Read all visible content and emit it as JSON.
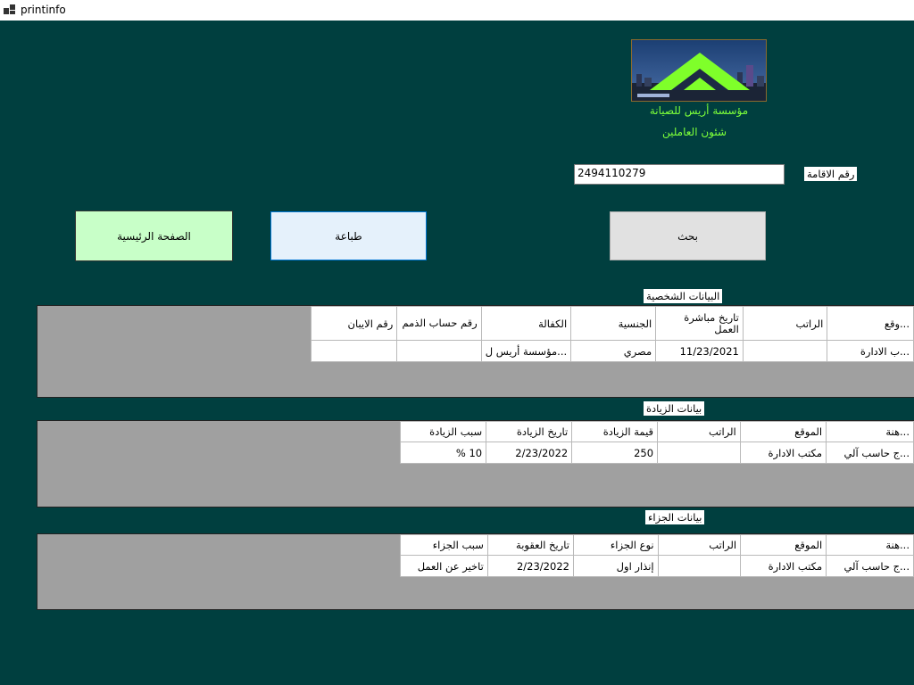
{
  "window": {
    "title": "printinfo"
  },
  "header": {
    "company_name": "مؤسسة أريس للصيانة",
    "department": "شئون العاملين"
  },
  "search": {
    "label": "رقم الاقامة",
    "value": "2494110279"
  },
  "buttons": {
    "home": "الصفحة الرئيسية",
    "print": "طباعة",
    "search": "بحث"
  },
  "colors": {
    "background": "#003f3f",
    "accent_text": "#7cff3a",
    "home_button": "#c8ffc8",
    "print_button": "#e5f1fb",
    "search_button": "#e1e1e1"
  },
  "personal": {
    "section_label": "البيانات الشخصية",
    "columns": [
      "...وقع",
      "الراتب",
      "تاريخ مباشرة العمل",
      "الجنسية",
      "الكفالة",
      "رقم حساب الذمم",
      "رقم الايبان"
    ],
    "row": [
      "...ب الادارة",
      "",
      "11/23/2021",
      "مصري",
      "...مؤسسة أريس ل",
      "",
      ""
    ]
  },
  "increase": {
    "section_label": "بيانات الزيادة",
    "columns": [
      "...هنة",
      "الموقع",
      "الراتب",
      "قيمة الزيادة",
      "تاريخ الزيادة",
      "سبب الزيادة"
    ],
    "row": [
      "...ج حاسب آلي",
      "مكتب الادارة",
      "",
      "250",
      "2/23/2022",
      "10 %"
    ]
  },
  "penalty": {
    "section_label": "بيانات الجزاء",
    "columns": [
      "...هنة",
      "الموقع",
      "الراتب",
      "نوع الجزاء",
      "تاريخ العقوبة",
      "سبب الجزاء"
    ],
    "row": [
      "...ج حاسب آلي",
      "مكتب الادارة",
      "",
      "إنذار اول",
      "2/23/2022",
      "تاخير عن العمل"
    ]
  }
}
